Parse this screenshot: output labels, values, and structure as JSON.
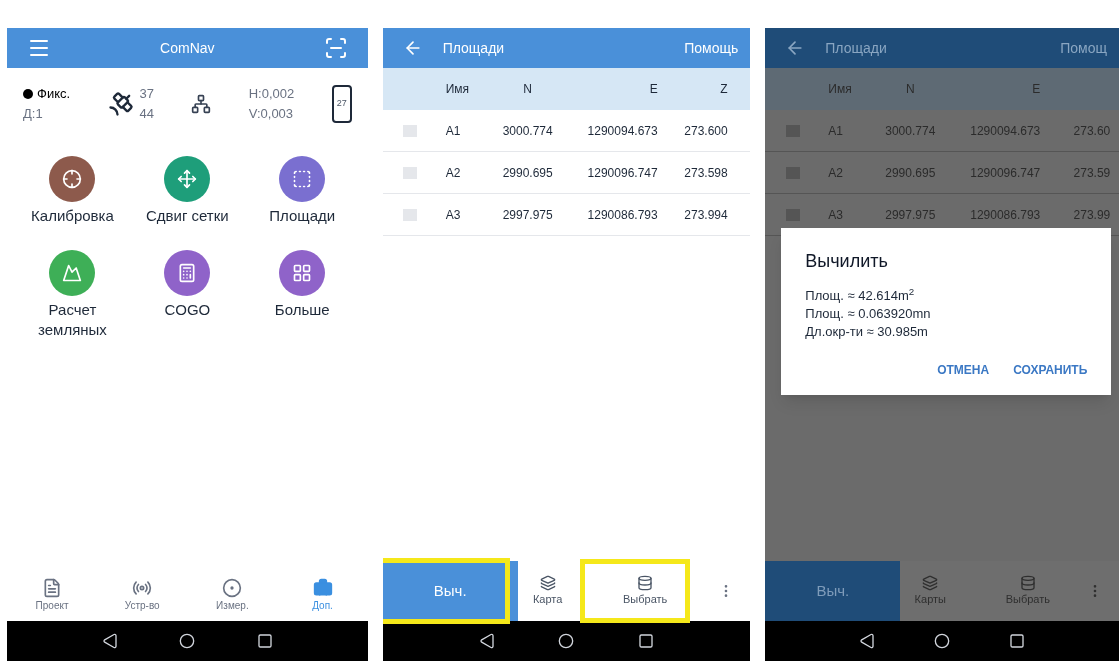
{
  "home": {
    "title": "ComNav",
    "status": {
      "fix": "Фикс.",
      "age": "Д:1",
      "sat_used": "37",
      "sat_total": "44",
      "h": "H:0,002",
      "v": "V:0,003",
      "battery": "27"
    },
    "tools": [
      {
        "label": "Калибровка",
        "color": "#8d5a4c",
        "kind": "calibration"
      },
      {
        "label": "Сдвиг сетки",
        "color": "#1e9e7a",
        "kind": "shift"
      },
      {
        "label": "Площади",
        "color": "#7a6fd0",
        "kind": "area"
      },
      {
        "label": "Расчет земляных",
        "color": "#3eaf57",
        "kind": "earth"
      },
      {
        "label": "COGO",
        "color": "#8f63c9",
        "kind": "cogo"
      },
      {
        "label": "Больше",
        "color": "#8f63c9",
        "kind": "more"
      }
    ],
    "tabs": [
      {
        "label": "Проект",
        "selected": false,
        "kind": "project"
      },
      {
        "label": "Устр-во",
        "selected": false,
        "kind": "device"
      },
      {
        "label": "Измер.",
        "selected": false,
        "kind": "measure"
      },
      {
        "label": "Доп.",
        "selected": true,
        "kind": "extra"
      }
    ]
  },
  "area": {
    "title": "Площади",
    "help": "Помощь",
    "columns": [
      "Имя",
      "N",
      "E",
      "Z"
    ],
    "rows": [
      {
        "checked": false,
        "cells": [
          "A1",
          "3000.774",
          "1290094.673",
          "273.600"
        ]
      },
      {
        "checked": false,
        "cells": [
          "A2",
          "2990.695",
          "1290096.747",
          "273.598"
        ]
      },
      {
        "checked": false,
        "cells": [
          "A3",
          "2997.975",
          "1290086.793",
          "273.994"
        ]
      }
    ],
    "compute": "Выч.",
    "map": "Карта",
    "select": "Выбрать"
  },
  "result": {
    "title": "Площади",
    "help": "Помощ",
    "columns": [
      "Имя",
      "N",
      "E"
    ],
    "rows": [
      {
        "checked": false,
        "cells": [
          "A1",
          "3000.774",
          "1290094.673",
          "273.60"
        ]
      },
      {
        "checked": false,
        "cells": [
          "A2",
          "2990.695",
          "1290096.747",
          "273.59"
        ]
      },
      {
        "checked": false,
        "cells": [
          "A3",
          "2997.975",
          "1290086.793",
          "273.99"
        ]
      }
    ],
    "compute": "Выч.",
    "map": "Карты",
    "select": "Выбрать",
    "dialog": {
      "title": "Вычилить",
      "lines": [
        "Площ. ≈ 42.614m$^{2}$",
        "Площ. ≈ 0.063920mn",
        "Дл.окр-ти ≈ 30.985m"
      ],
      "cancel": "ОТМЕНА",
      "save": "СОХРАНИТЬ"
    }
  }
}
